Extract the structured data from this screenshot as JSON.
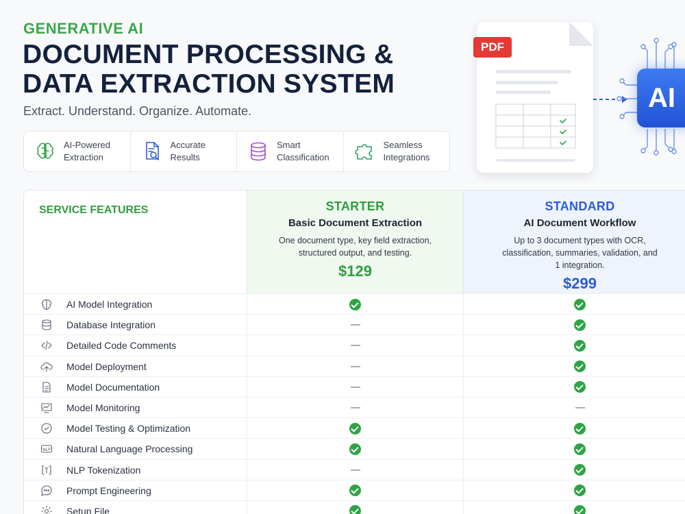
{
  "header": {
    "eyebrow": "GENERATIVE AI",
    "title_line1": "DOCUMENT PROCESSING &",
    "title_line2": "DATA EXTRACTION SYSTEM",
    "tagline": "Extract. Understand. Organize. Automate."
  },
  "features": [
    {
      "label": "AI-Powered\nExtraction",
      "icon": "brain-icon"
    },
    {
      "label": "Accurate\nResults",
      "icon": "document-search-icon"
    },
    {
      "label": "Smart\nClassification",
      "icon": "database-icon"
    },
    {
      "label": "Seamless\nIntegrations",
      "icon": "puzzle-icon"
    }
  ],
  "hero": {
    "pdf_badge": "PDF",
    "ai_chip": "AI"
  },
  "table": {
    "features_heading": "SERVICE FEATURES",
    "plans": [
      {
        "name": "STARTER",
        "subtitle": "Basic Document Extraction",
        "description": "One document type, key field extraction, structured output, and testing.",
        "price": "$129",
        "accent": "#2f9e3f"
      },
      {
        "name": "STANDARD",
        "subtitle": "AI Document Workflow",
        "description": "Up to 3 document types with OCR, classification, summaries, validation, and 1 integration.",
        "price": "$299",
        "accent": "#2b5cd6"
      }
    ],
    "rows": [
      {
        "label": "AI Model Integration",
        "icon": "brain-icon",
        "starter": "check",
        "standard": "check"
      },
      {
        "label": "Database Integration",
        "icon": "database-icon",
        "starter": "dash",
        "standard": "check"
      },
      {
        "label": "Detailed Code Comments",
        "icon": "code-icon",
        "starter": "dash",
        "standard": "check"
      },
      {
        "label": "Model Deployment",
        "icon": "cloud-upload-icon",
        "starter": "dash",
        "standard": "check"
      },
      {
        "label": "Model Documentation",
        "icon": "document-icon",
        "starter": "dash",
        "standard": "check"
      },
      {
        "label": "Model Monitoring",
        "icon": "monitor-chart-icon",
        "starter": "dash",
        "standard": "dash"
      },
      {
        "label": "Model Testing & Optimization",
        "icon": "check-circle-icon",
        "starter": "check",
        "standard": "check"
      },
      {
        "label": "Natural Language Processing",
        "icon": "nlp-icon",
        "starter": "check",
        "standard": "check"
      },
      {
        "label": "NLP Tokenization",
        "icon": "token-icon",
        "starter": "dash",
        "standard": "check"
      },
      {
        "label": "Prompt Engineering",
        "icon": "chat-icon",
        "starter": "check",
        "standard": "check"
      },
      {
        "label": "Setup File",
        "icon": "gear-icon",
        "starter": "check",
        "standard": "check"
      }
    ]
  }
}
